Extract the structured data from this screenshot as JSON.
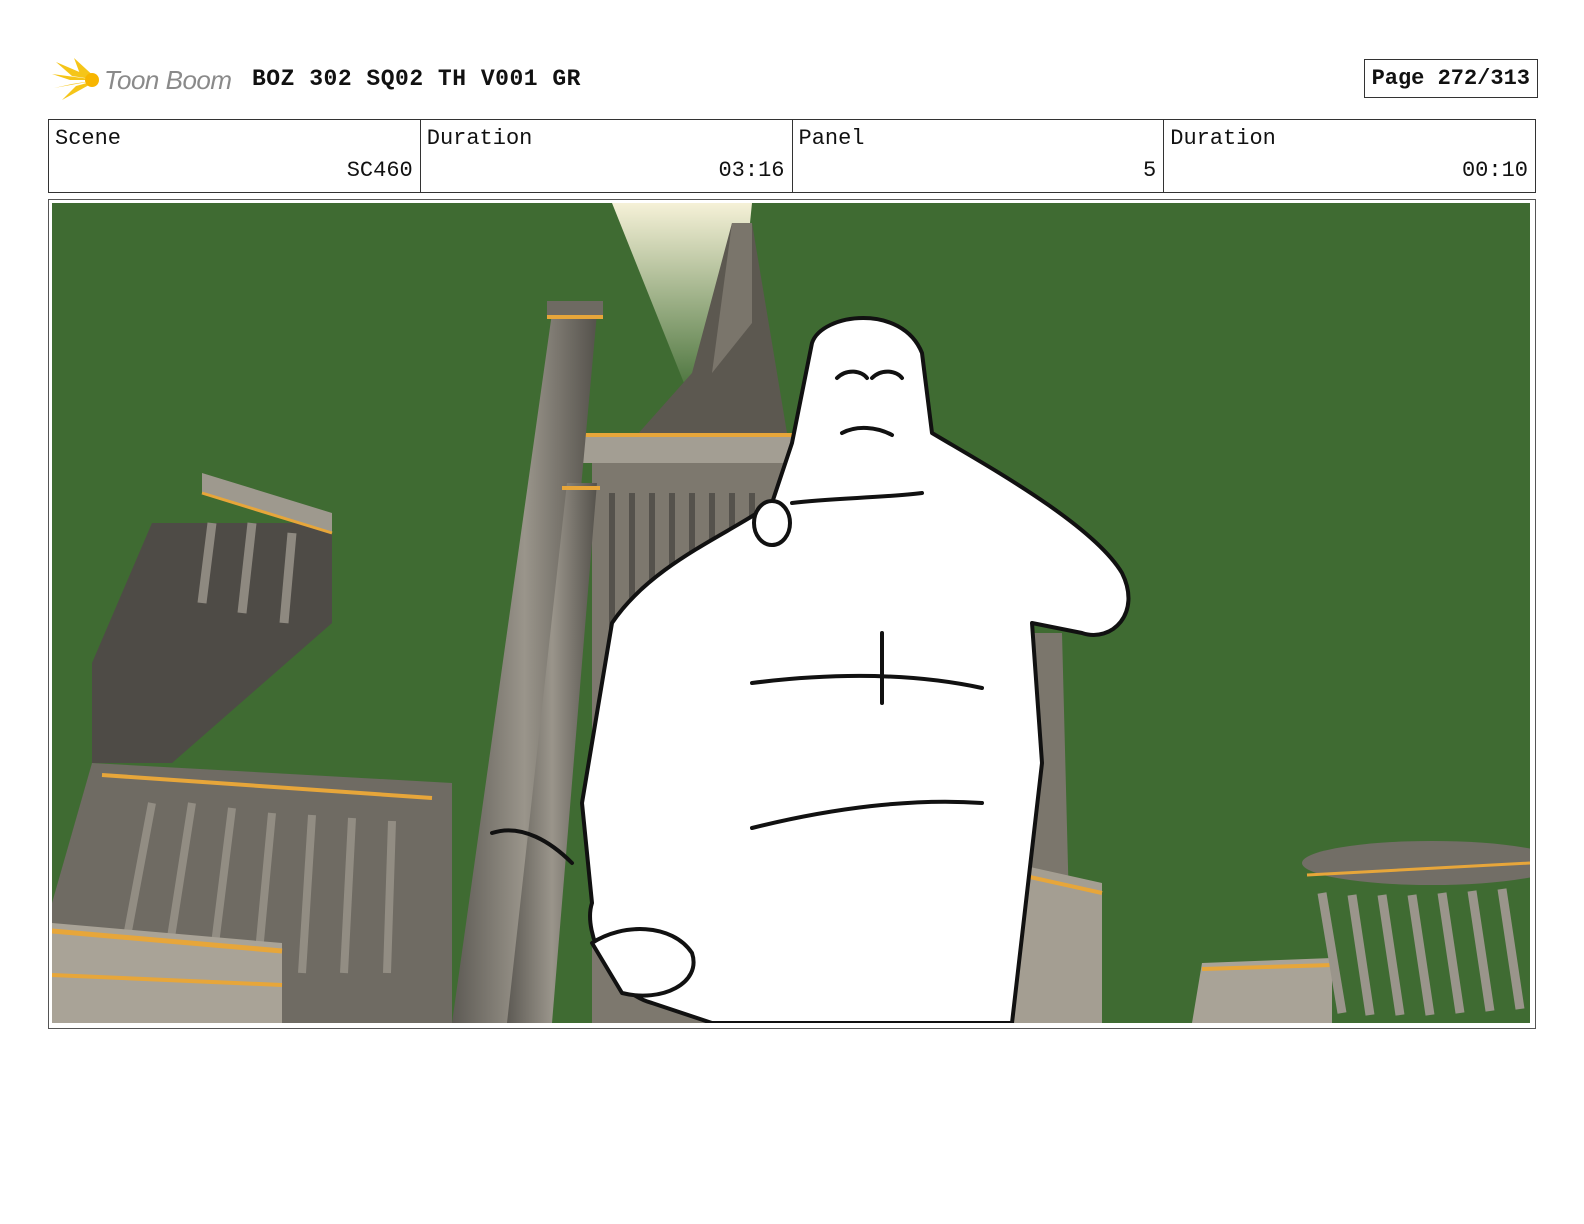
{
  "header": {
    "logo_text": "Toon Boom",
    "title": "BOZ 302 SQ02 TH V001 GR",
    "page": "Page 272/313"
  },
  "info": {
    "scene_label": "Scene",
    "scene_value": "SC460",
    "scene_duration_label": "Duration",
    "scene_duration_value": "03:16",
    "panel_label": "Panel",
    "panel_value": "5",
    "panel_duration_label": "Duration",
    "panel_duration_value": "00:10"
  },
  "colors": {
    "background_green": "#3f6b32",
    "stone": "#8a857c",
    "gold_trim": "#e7a63a",
    "logo_yellow": "#f5c518"
  },
  "icons": [
    "toon-boom-logo-icon"
  ]
}
